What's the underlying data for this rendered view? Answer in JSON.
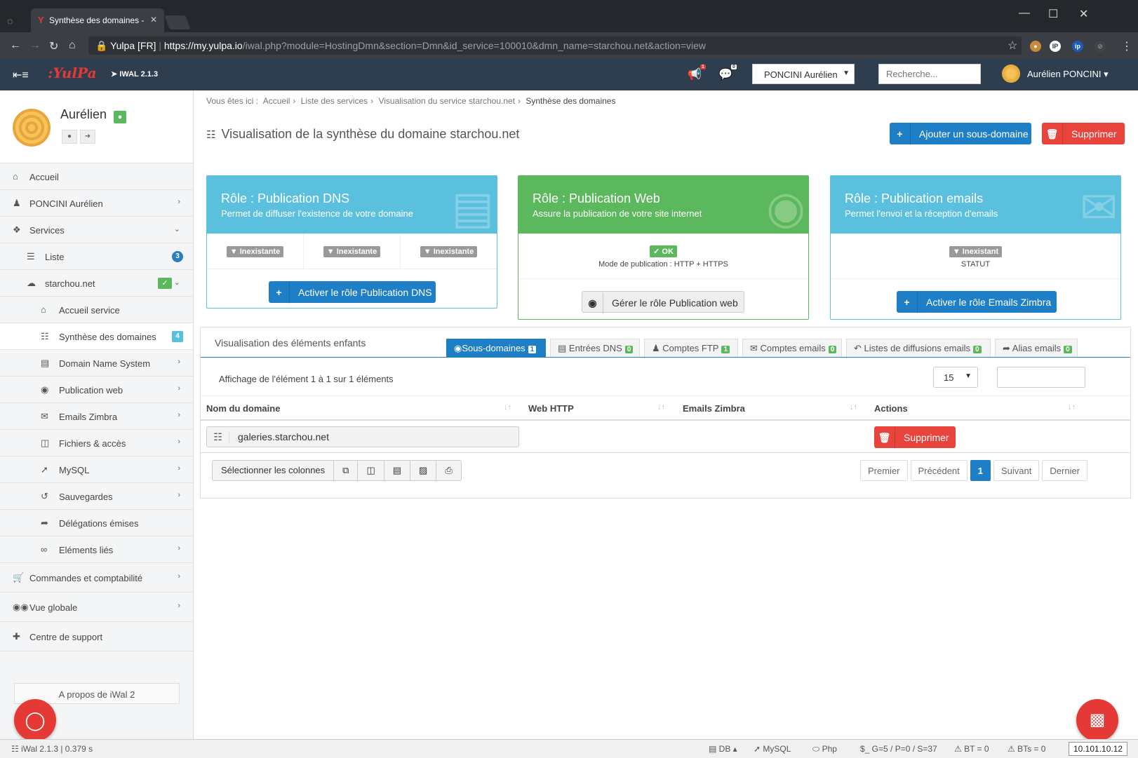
{
  "browser": {
    "tab_title": "Synthèse des domaines -",
    "url_site": "Yulpa [FR]",
    "url_scheme": "https://",
    "url_host": "my.yulpa.io",
    "url_path": "/iwal.php?module=HostingDmn&section=Dmn&id_service=100010&dmn_name=starchou.net&action=view"
  },
  "appbar": {
    "logo": ":YulPa",
    "version": "IWAL 2.1.3",
    "notif_count": "1",
    "msg_count": "0",
    "account_select": "PONCINI Aurélien",
    "search_placeholder": "Recherche...",
    "user_name": "Aurélien PONCINI"
  },
  "profile": {
    "name": "Aurélien"
  },
  "sidebar": {
    "items": [
      {
        "label": "Accueil"
      },
      {
        "label": "PONCINI Aurélien"
      },
      {
        "label": "Services"
      },
      {
        "label": "Liste",
        "count": "3"
      },
      {
        "label": "starchou.net"
      },
      {
        "label": "Accueil service"
      },
      {
        "label": "Synthèse des domaines",
        "count": "4"
      },
      {
        "label": "Domain Name System"
      },
      {
        "label": "Publication web"
      },
      {
        "label": "Emails Zimbra"
      },
      {
        "label": "Fichiers & accès"
      },
      {
        "label": "MySQL"
      },
      {
        "label": "Sauvegardes"
      },
      {
        "label": "Délégations émises"
      },
      {
        "label": "Eléments liés"
      },
      {
        "label": "Commandes et comptabilité"
      },
      {
        "label": "Vue globale"
      },
      {
        "label": "Centre de support"
      }
    ],
    "about": "A propos de iWal 2"
  },
  "breadcrumb": {
    "prefix": "Vous êtes ici :",
    "items": [
      "Accueil",
      "Liste des services",
      "Visualisation du service starchou.net"
    ],
    "current": "Synthèse des domaines"
  },
  "page": {
    "title": "Visualisation de la synthèse du domaine starchou.net",
    "add_button": "Ajouter un sous-domaine",
    "delete_button": "Supprimer"
  },
  "roles": {
    "dns": {
      "title": "Rôle : Publication DNS",
      "subtitle": "Permet de diffuser l'existence de votre domaine",
      "status": [
        "Inexistante",
        "Inexistante",
        "Inexistante"
      ],
      "button": "Activer le rôle Publication DNS",
      "color": "#5bc0de"
    },
    "web": {
      "title": "Rôle : Publication Web",
      "subtitle": "Assure la publication de votre site internet",
      "status": "OK",
      "mode": "Mode de publication : HTTP + HTTPS",
      "button": "Gérer le rôle Publication web",
      "color": "#5cb85c"
    },
    "emails": {
      "title": "Rôle : Publication emails",
      "subtitle": "Permet l'envoi et la réception d'emails",
      "status": "Inexistant",
      "status_label": "STATUT",
      "button": "Activer le rôle Emails Zimbra",
      "color": "#5bc0de"
    }
  },
  "children": {
    "title": "Visualisation des éléments enfants",
    "tabs": [
      {
        "label": "Sous-domaines",
        "count": "1"
      },
      {
        "label": "Entrées DNS",
        "count": "0"
      },
      {
        "label": "Comptes FTP",
        "count": "1"
      },
      {
        "label": "Comptes emails",
        "count": "0"
      },
      {
        "label": "Listes de diffusions emails",
        "count": "0"
      },
      {
        "label": "Alias emails",
        "count": "0"
      }
    ],
    "info": "Affichage de l'élément 1 à 1 sur 1 éléments",
    "per_page": "15",
    "columns": [
      "Nom du domaine",
      "Web HTTP",
      "Emails Zimbra",
      "Actions"
    ],
    "rows": [
      {
        "domain": "galeries.starchou.net",
        "action": "Supprimer"
      }
    ],
    "column_select": "Sélectionner les colonnes",
    "pager": [
      "Premier",
      "Précédent",
      "1",
      "Suivant",
      "Dernier"
    ]
  },
  "statusbar": {
    "app": "iWal 2.1.3 | 0.379 s",
    "db": "DB",
    "mysql": "MySQL",
    "php": "Php",
    "globals": "$_ G=5 / P=0 / S=37",
    "bt": "BT = 0",
    "bts": "BTs = 0",
    "ip": "10.101.10.12"
  }
}
